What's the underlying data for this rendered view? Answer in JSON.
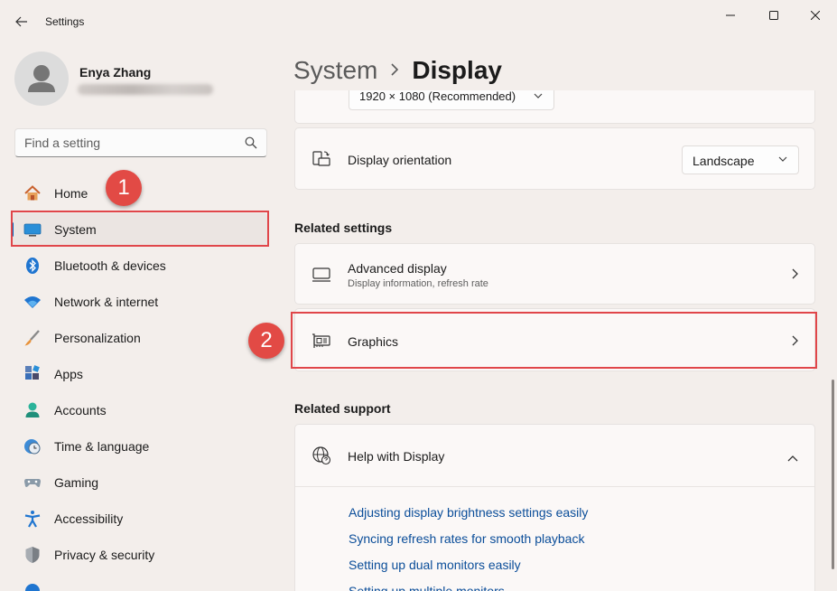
{
  "window": {
    "app_title": "Settings",
    "back_icon": "back-arrow-icon",
    "controls": [
      "minimize-icon",
      "maximize-icon",
      "close-icon"
    ]
  },
  "user": {
    "name": "Enya Zhang",
    "avatar_icon": "person-icon"
  },
  "search": {
    "placeholder": "Find a setting",
    "icon": "search-icon"
  },
  "sidebar": {
    "items": [
      {
        "label": "Home",
        "icon": "home-icon"
      },
      {
        "label": "System",
        "icon": "monitor-icon",
        "selected": true
      },
      {
        "label": "Bluetooth & devices",
        "icon": "bluetooth-icon"
      },
      {
        "label": "Network & internet",
        "icon": "wifi-icon"
      },
      {
        "label": "Personalization",
        "icon": "brush-icon"
      },
      {
        "label": "Apps",
        "icon": "apps-icon"
      },
      {
        "label": "Accounts",
        "icon": "account-icon"
      },
      {
        "label": "Time & language",
        "icon": "clock-globe-icon"
      },
      {
        "label": "Gaming",
        "icon": "gamepad-icon"
      },
      {
        "label": "Accessibility",
        "icon": "accessibility-icon"
      },
      {
        "label": "Privacy & security",
        "icon": "shield-icon"
      }
    ]
  },
  "annotations": {
    "badge1": "1",
    "badge2": "2",
    "color": "#e24a45"
  },
  "breadcrumb": {
    "parent": "System",
    "separator": ">",
    "current": "Display"
  },
  "display": {
    "resolution_value": "1920 × 1080 (Recommended)",
    "orientation": {
      "label": "Display orientation",
      "value": "Landscape",
      "icon": "orientation-icon"
    }
  },
  "related_settings": {
    "title": "Related settings",
    "items": [
      {
        "title": "Advanced display",
        "subtitle": "Display information, refresh rate",
        "icon": "monitor-outline-icon"
      },
      {
        "title": "Graphics",
        "icon": "graphics-card-icon"
      }
    ]
  },
  "related_support": {
    "title": "Related support",
    "help": {
      "title": "Help with Display",
      "icon": "globe-help-icon",
      "links": [
        "Adjusting display brightness settings easily",
        "Syncing refresh rates for smooth playback",
        "Setting up dual monitors easily",
        "Setting up multiple monitors"
      ]
    }
  },
  "colors": {
    "accent": "#0067c0",
    "link": "#0a4d99",
    "highlight_border": "#e0464a",
    "background": "#f3eeeb"
  }
}
